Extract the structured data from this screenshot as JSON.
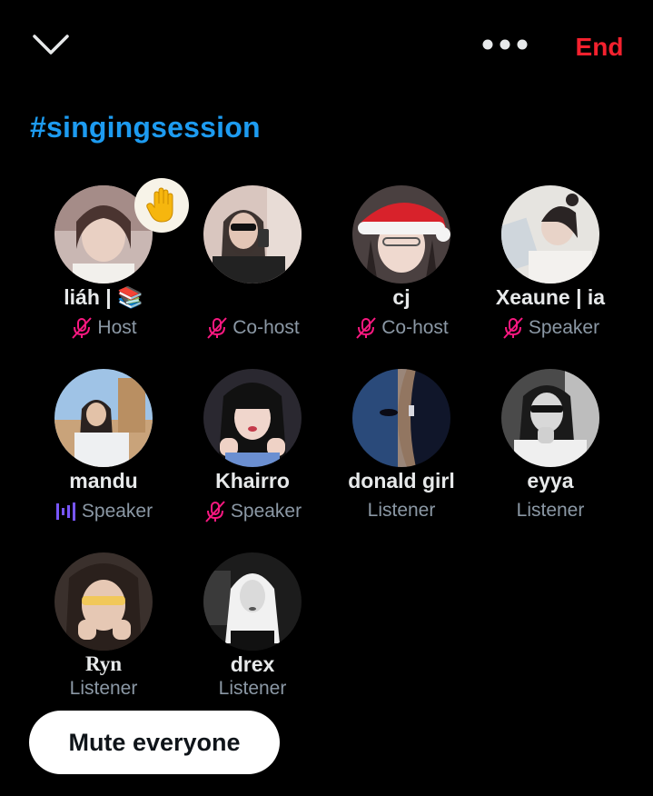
{
  "header": {
    "collapse_icon": "chevron-down-icon",
    "more_icon": "more-horizontal-icon",
    "end_label": "End",
    "end_color": "#f4212e"
  },
  "space": {
    "title": "#singingsession",
    "title_color": "#1d9bf0"
  },
  "participants": [
    {
      "name": "liáh | 📚",
      "role": "Host",
      "role_icon": "mic-off-icon",
      "raised_hand": true
    },
    {
      "name": "",
      "role": "Co-host",
      "role_icon": "mic-off-icon"
    },
    {
      "name": "cj",
      "role": "Co-host",
      "role_icon": "mic-off-icon"
    },
    {
      "name": "Xeaune | ia",
      "role": "Speaker",
      "role_icon": "mic-off-icon"
    },
    {
      "name": "mandu",
      "role": "Speaker",
      "role_icon": "speaking-waveform-icon"
    },
    {
      "name": "Khairro",
      "role": "Speaker",
      "role_icon": "mic-off-icon"
    },
    {
      "name": "donald girl",
      "role": "Listener",
      "role_icon": ""
    },
    {
      "name": "eyya",
      "role": "Listener",
      "role_icon": ""
    },
    {
      "name": "Ryn",
      "role": "Listener",
      "role_icon": ""
    },
    {
      "name": "drex",
      "role": "Listener",
      "role_icon": ""
    }
  ],
  "actions": {
    "mute_everyone_label": "Mute everyone"
  },
  "colors": {
    "mic_off": "#f91880",
    "speaking": "#7856ff",
    "role_text": "#8b98a5"
  }
}
